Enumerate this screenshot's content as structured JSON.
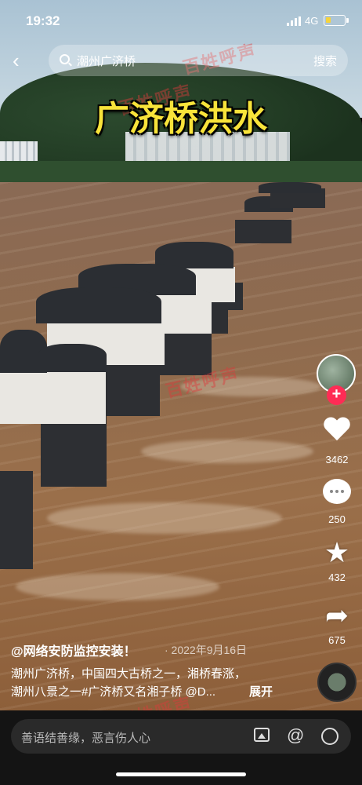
{
  "status_bar": {
    "time": "19:32",
    "network": "4G"
  },
  "search": {
    "query": "潮州广济桥",
    "button": "搜索"
  },
  "video": {
    "overlay_title": "广济桥洪水",
    "watermark": "百姓呼声"
  },
  "actions": {
    "likes": "3462",
    "comments": "250",
    "favorites": "432",
    "shares": "675"
  },
  "post": {
    "author": "@网络安防监控安装！",
    "date": "· 2022年9月16日",
    "caption_line1": "潮州广济桥，中国四大古桥之一，湘桥春涨，",
    "caption_line2": "潮州八景之一#广济桥又名湘子桥 @D...",
    "expand": "展开"
  },
  "comment_bar": {
    "placeholder": "善语结善缘，恶言伤人心"
  }
}
